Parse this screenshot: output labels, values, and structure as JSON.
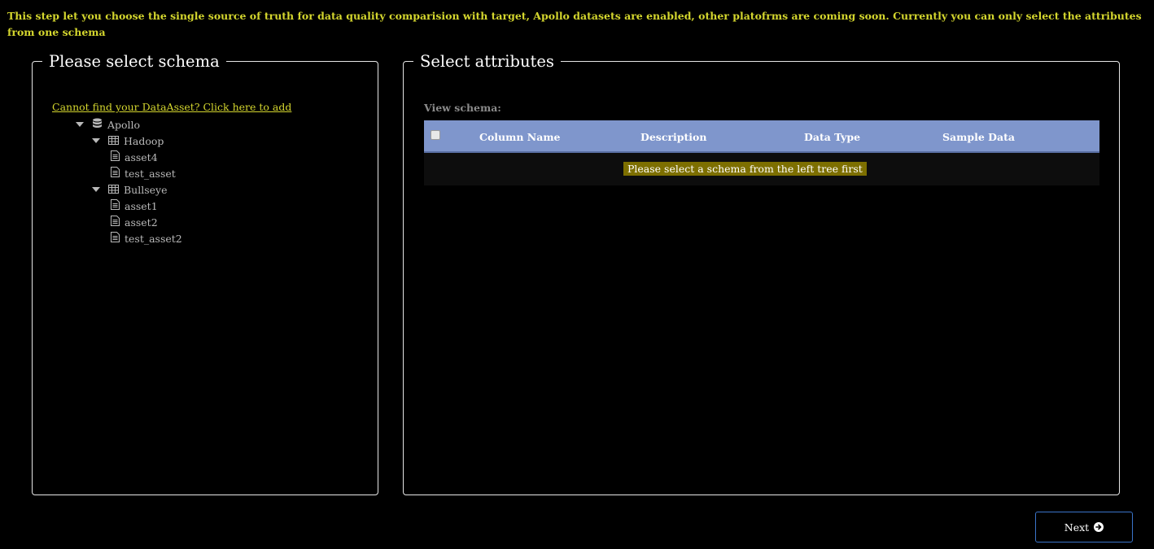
{
  "intro_text": "This step let you choose the single source of truth for data quality comparision with target, Apollo datasets are enabled, other platofrms are coming soon. Currently you can only select the attributes from one schema",
  "left_panel": {
    "title": "Please select schema",
    "add_link": "Cannot find your DataAsset? Click here to add",
    "tree": {
      "root": {
        "label": "Apollo",
        "icon": "database-icon"
      },
      "groups": [
        {
          "label": "Hadoop",
          "icon": "table-icon",
          "items": [
            "asset4",
            "test_asset"
          ]
        },
        {
          "label": "Bullseye",
          "icon": "table-icon",
          "items": [
            "asset1",
            "asset2",
            "test_asset2"
          ]
        }
      ]
    }
  },
  "right_panel": {
    "title": "Select attributes",
    "view_schema_label": "View schema:",
    "columns": [
      "Column Name",
      "Description",
      "Data Type",
      "Sample Data"
    ],
    "empty_message": "Please select a schema from the left tree first"
  },
  "next_button": {
    "label": "Next",
    "icon": "arrow-circle-right-icon"
  },
  "colors": {
    "accent_yellow": "#d4d62e",
    "grid_header": "#7f96cc",
    "empty_badge": "#7d6f00",
    "button_border": "#3a74c9"
  }
}
